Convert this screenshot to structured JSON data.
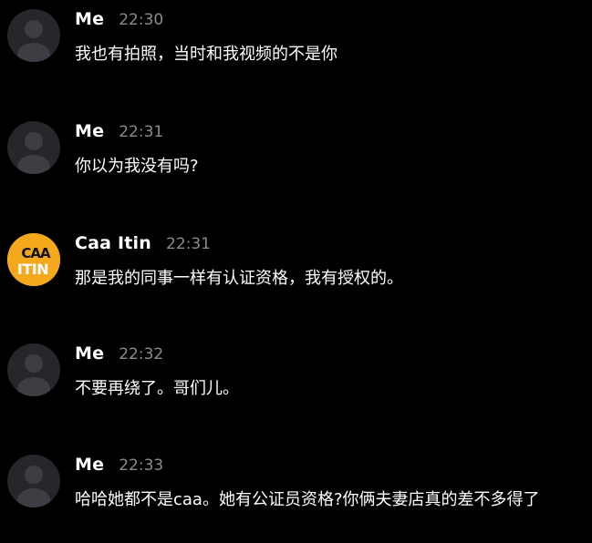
{
  "colors": {
    "background": "#000000",
    "sender_name": "#ffffff",
    "timestamp": "#8a8a90",
    "message_text": "#ffffff",
    "default_avatar": "#26262b",
    "brand_avatar": "#f4a81c"
  },
  "messages": [
    {
      "sender": "Me",
      "time": "22:30",
      "text": "我也有拍照，当时和我视频的不是你",
      "avatar": "default-user-icon"
    },
    {
      "sender": "Me",
      "time": "22:31",
      "text": "你以为我没有吗?",
      "avatar": "default-user-icon"
    },
    {
      "sender": "Caa Itin",
      "time": "22:31",
      "text": "那是我的同事一样有认证资格，我有授权的。",
      "avatar": "caa-itin-logo",
      "avatar_logo_text": "CAA ITIN"
    },
    {
      "sender": "Me",
      "time": "22:32",
      "text": "不要再绕了。哥们儿。",
      "avatar": "default-user-icon"
    },
    {
      "sender": "Me",
      "time": "22:33",
      "text": "哈哈她都不是caa。她有公证员资格?你俩夫妻店真的差不多得了",
      "avatar": "default-user-icon"
    }
  ]
}
